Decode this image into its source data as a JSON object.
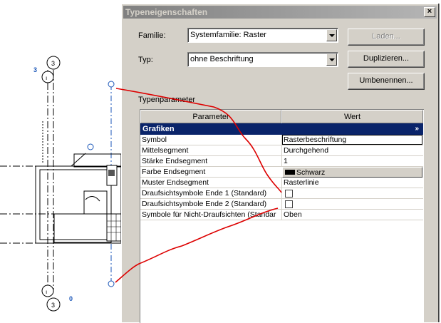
{
  "dialog": {
    "title": "Typeneigenschaften",
    "close_glyph": "×",
    "family_label": "Familie:",
    "family_value": "Systemfamilie: Raster",
    "type_label": "Typ:",
    "type_value": "ohne Beschriftung",
    "load_button": "Laden...",
    "duplicate_button": "Duplizieren...",
    "rename_button": "Umbenennen...",
    "type_params_label": "Typenparameter"
  },
  "grid": {
    "col_param": "Parameter",
    "col_value": "Wert",
    "group": "Grafiken",
    "group_chevron": "»",
    "rows": [
      {
        "param": "Symbol",
        "value": "Rasterbeschriftung"
      },
      {
        "param": "Mittelsegment",
        "value": "Durchgehend"
      },
      {
        "param": "Stärke Endsegment",
        "value": "1"
      },
      {
        "param": "Farbe Endsegment",
        "value": "Schwarz"
      },
      {
        "param": "Muster Endsegment",
        "value": "Rasterlinie"
      },
      {
        "param": "Draufsichtsymbole Ende 1 (Standard)",
        "value": ""
      },
      {
        "param": "Draufsichtsymbole Ende 2 (Standard)",
        "value": ""
      },
      {
        "param": "Symbole für Nicht-Draufsichten (Standar",
        "value": "Oben"
      }
    ]
  },
  "drawing": {
    "grid_bubble_top": "3",
    "grid_bubble_bottom": "3",
    "left_label": "3",
    "bottom_label": "0"
  },
  "colors": {
    "title_gradient_start": "#808080",
    "selection": "#0a246a",
    "annotation": "#dd0000",
    "drawing_blue": "#1a56b8"
  }
}
